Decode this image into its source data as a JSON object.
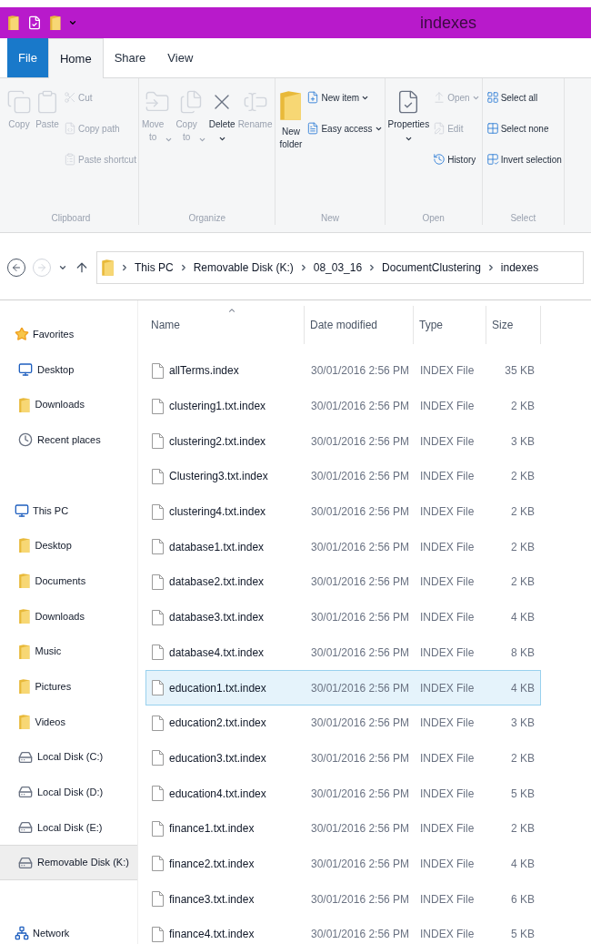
{
  "window": {
    "title": "indexes"
  },
  "ribbon_tabs": [
    {
      "label": "File",
      "kind": "file",
      "selected": false
    },
    {
      "label": "Home",
      "kind": "tab",
      "selected": true
    },
    {
      "label": "Share",
      "kind": "tab",
      "selected": false
    },
    {
      "label": "View",
      "kind": "tab",
      "selected": false
    }
  ],
  "ribbon_groups": [
    {
      "label": "Clipboard",
      "large": [
        {
          "label": "Copy",
          "disabled": true
        },
        {
          "label": "Paste",
          "disabled": true
        }
      ],
      "small": [
        {
          "label": "Cut",
          "disabled": true
        },
        {
          "label": "Copy path",
          "disabled": true
        },
        {
          "label": "Paste shortcut",
          "disabled": true
        }
      ]
    },
    {
      "label": "Organize",
      "large": [
        {
          "label": "Move to",
          "disabled": true,
          "dropdown": true,
          "caret_below": false
        },
        {
          "label": "Copy to",
          "disabled": true,
          "dropdown": true,
          "caret_below": false
        },
        {
          "label": "Delete",
          "disabled": false,
          "dropdown": true,
          "caret_below": true
        },
        {
          "label": "Rename",
          "disabled": true
        }
      ]
    },
    {
      "label": "New",
      "large": [
        {
          "label": "New folder",
          "disabled": false
        }
      ],
      "small": [
        {
          "label": "New item",
          "disabled": false,
          "dropdown": true
        },
        {
          "label": "Easy access",
          "disabled": false,
          "dropdown": true
        }
      ]
    },
    {
      "label": "Open",
      "large": [
        {
          "label": "Properties",
          "disabled": false,
          "dropdown": true,
          "caret_below": true
        }
      ],
      "small": [
        {
          "label": "Open",
          "disabled": true,
          "dropdown": true
        },
        {
          "label": "Edit",
          "disabled": true
        },
        {
          "label": "History",
          "disabled": false
        }
      ]
    },
    {
      "label": "Select",
      "small": [
        {
          "label": "Select all",
          "disabled": false
        },
        {
          "label": "Select none",
          "disabled": false
        },
        {
          "label": "Invert selection",
          "disabled": false
        }
      ]
    }
  ],
  "address_bar": {
    "back_disabled": false,
    "forward_disabled": true,
    "path": [
      "This PC",
      "Removable Disk (K:)",
      "08_03_16",
      "DocumentClustering",
      "indexes"
    ]
  },
  "sidebar": {
    "groups": [
      {
        "label": "Favorites",
        "selected": false,
        "children": [
          {
            "label": "Desktop",
            "selected": false
          },
          {
            "label": "Downloads",
            "selected": false
          },
          {
            "label": "Recent places",
            "selected": false
          }
        ]
      },
      {
        "label": "This PC",
        "selected": false,
        "children": [
          {
            "label": "Desktop",
            "selected": false
          },
          {
            "label": "Documents",
            "selected": false
          },
          {
            "label": "Downloads",
            "selected": false
          },
          {
            "label": "Music",
            "selected": false
          },
          {
            "label": "Pictures",
            "selected": false
          },
          {
            "label": "Videos",
            "selected": false
          },
          {
            "label": "Local Disk (C:)",
            "selected": false
          },
          {
            "label": "Local Disk (D:)",
            "selected": false
          },
          {
            "label": "Local Disk (E:)",
            "selected": false
          },
          {
            "label": "Removable Disk (K:)",
            "selected": true
          }
        ]
      },
      {
        "label": "Network",
        "selected": false
      }
    ]
  },
  "file_list": {
    "columns": [
      "Name",
      "Date modified",
      "Type",
      "Size"
    ],
    "rows": [
      {
        "name": "allTerms.index",
        "date": "30/01/2016 2:56 PM",
        "type": "INDEX File",
        "size": "35 KB",
        "selected": false
      },
      {
        "name": "clustering1.txt.index",
        "date": "30/01/2016 2:56 PM",
        "type": "INDEX File",
        "size": "2 KB",
        "selected": false
      },
      {
        "name": "clustering2.txt.index",
        "date": "30/01/2016 2:56 PM",
        "type": "INDEX File",
        "size": "3 KB",
        "selected": false
      },
      {
        "name": "Clustering3.txt.index",
        "date": "30/01/2016 2:56 PM",
        "type": "INDEX File",
        "size": "2 KB",
        "selected": false
      },
      {
        "name": "clustering4.txt.index",
        "date": "30/01/2016 2:56 PM",
        "type": "INDEX File",
        "size": "2 KB",
        "selected": false
      },
      {
        "name": "database1.txt.index",
        "date": "30/01/2016 2:56 PM",
        "type": "INDEX File",
        "size": "2 KB",
        "selected": false
      },
      {
        "name": "database2.txt.index",
        "date": "30/01/2016 2:56 PM",
        "type": "INDEX File",
        "size": "2 KB",
        "selected": false
      },
      {
        "name": "database3.txt.index",
        "date": "30/01/2016 2:56 PM",
        "type": "INDEX File",
        "size": "4 KB",
        "selected": false
      },
      {
        "name": "database4.txt.index",
        "date": "30/01/2016 2:56 PM",
        "type": "INDEX File",
        "size": "8 KB",
        "selected": false
      },
      {
        "name": "education1.txt.index",
        "date": "30/01/2016 2:56 PM",
        "type": "INDEX File",
        "size": "4 KB",
        "selected": true
      },
      {
        "name": "education2.txt.index",
        "date": "30/01/2016 2:56 PM",
        "type": "INDEX File",
        "size": "3 KB",
        "selected": false
      },
      {
        "name": "education3.txt.index",
        "date": "30/01/2016 2:56 PM",
        "type": "INDEX File",
        "size": "2 KB",
        "selected": false
      },
      {
        "name": "education4.txt.index",
        "date": "30/01/2016 2:56 PM",
        "type": "INDEX File",
        "size": "5 KB",
        "selected": false
      },
      {
        "name": "finance1.txt.index",
        "date": "30/01/2016 2:56 PM",
        "type": "INDEX File",
        "size": "2 KB",
        "selected": false
      },
      {
        "name": "finance2.txt.index",
        "date": "30/01/2016 2:56 PM",
        "type": "INDEX File",
        "size": "4 KB",
        "selected": false
      },
      {
        "name": "finance3.txt.index",
        "date": "30/01/2016 2:56 PM",
        "type": "INDEX File",
        "size": "6 KB",
        "selected": false
      },
      {
        "name": "finance4.txt.index",
        "date": "30/01/2016 2:56 PM",
        "type": "INDEX File",
        "size": "5 KB",
        "selected": false
      }
    ]
  }
}
